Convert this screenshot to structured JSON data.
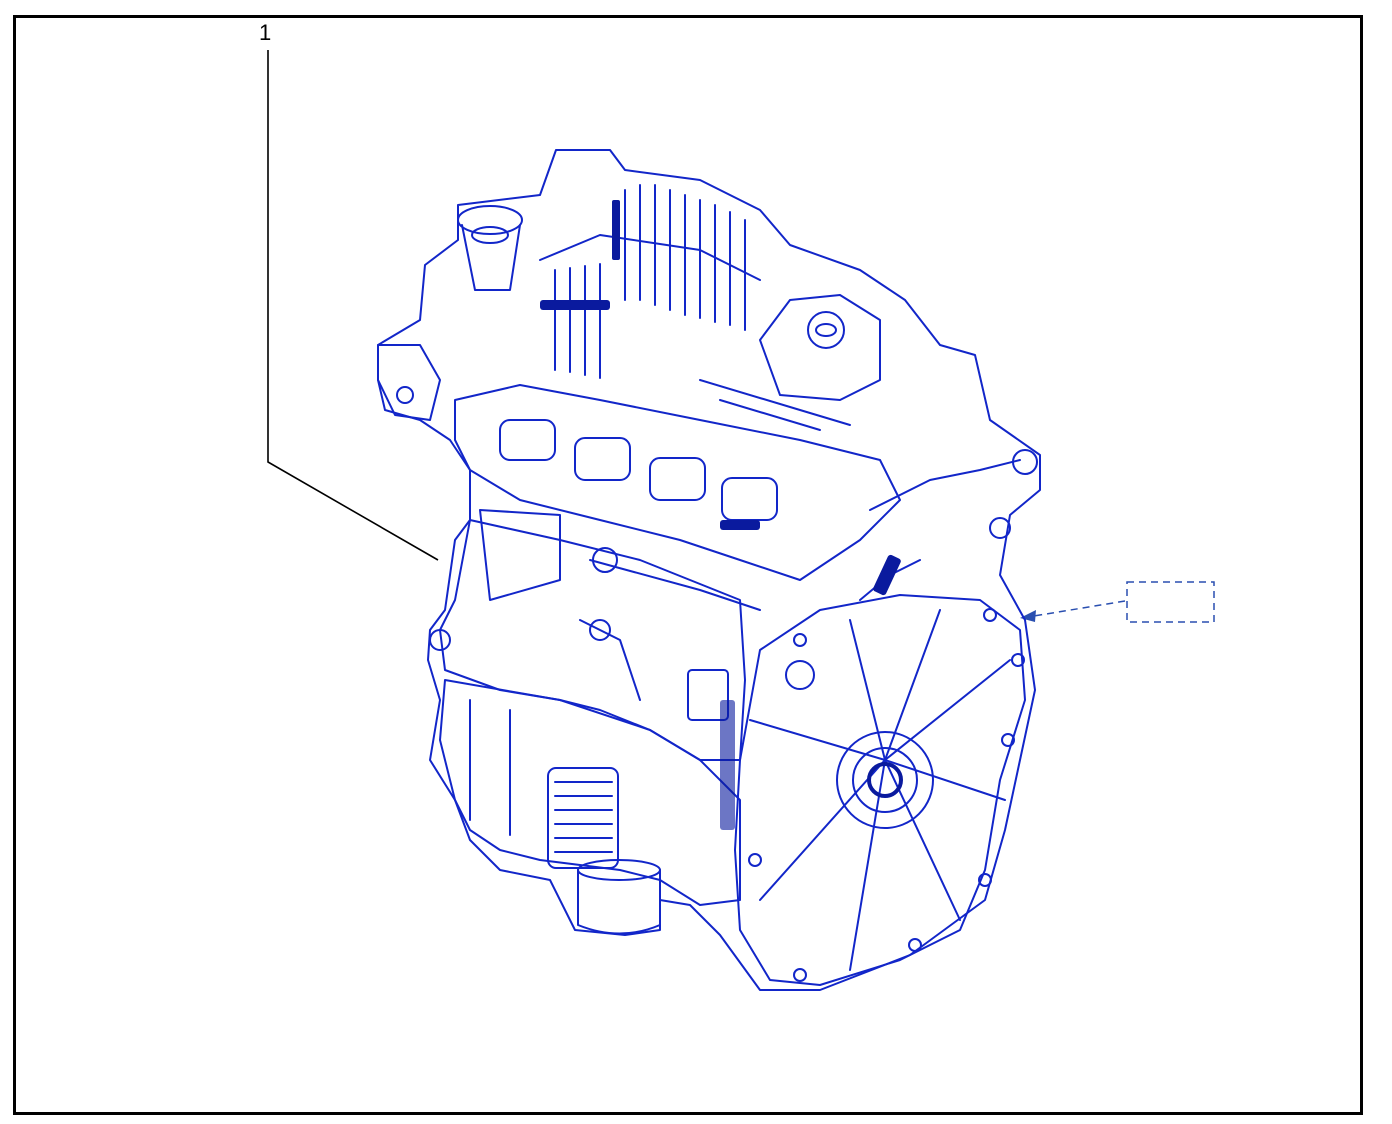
{
  "callouts": [
    {
      "label": "1"
    }
  ],
  "colors": {
    "frame": "#000000",
    "line_art": "#1226c9",
    "line_art_dark": "#0a1a9e",
    "reference_box": "#2a4fb0",
    "leader_line": "#000000"
  },
  "icons": {
    "part": "engine-assembly-drawing",
    "reference": "dashed-reference-box"
  }
}
